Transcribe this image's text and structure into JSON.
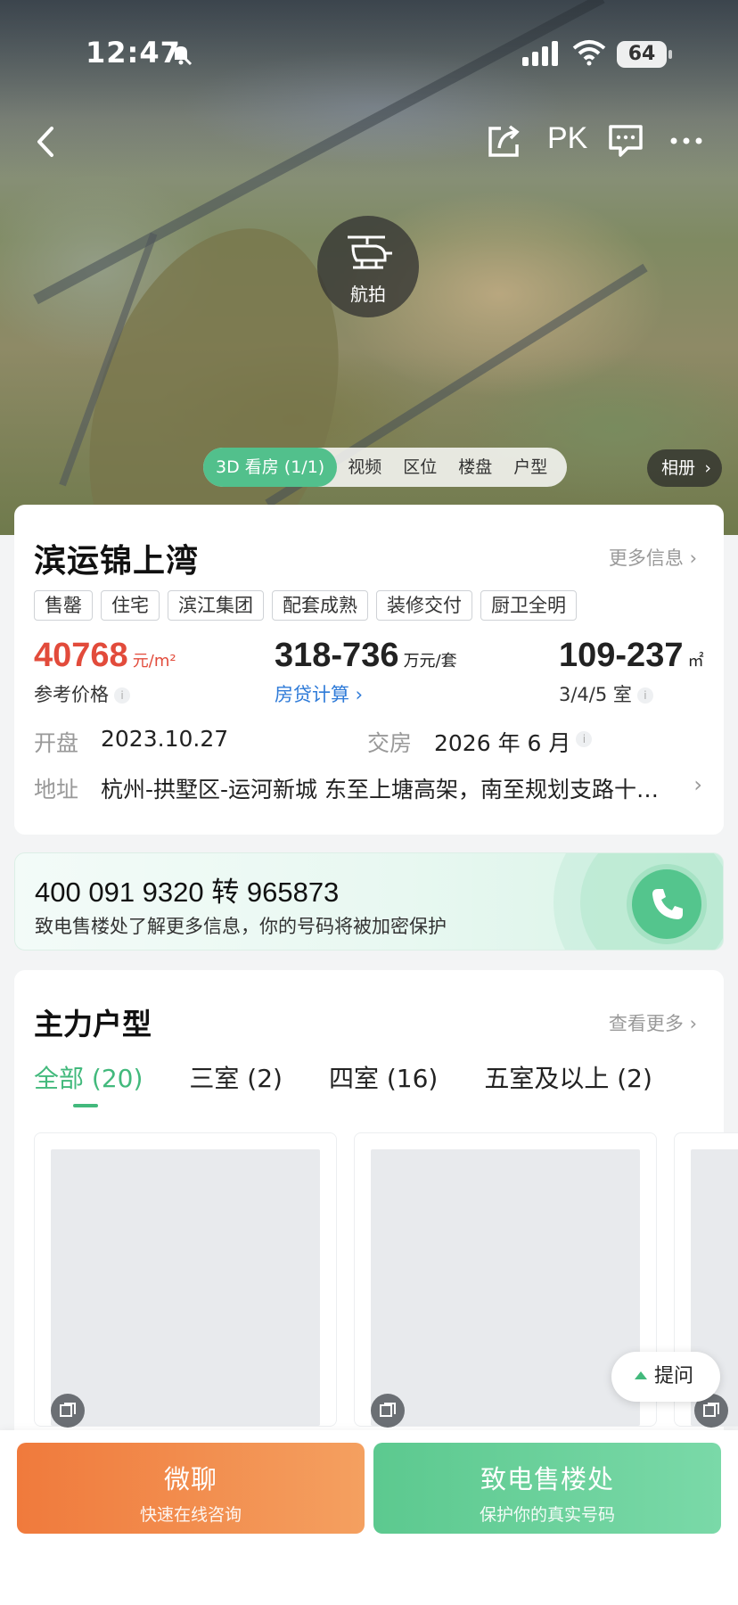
{
  "status_bar": {
    "time": "12:47",
    "battery": "64"
  },
  "nav": {
    "pk_label": "PK"
  },
  "hero": {
    "aerial_label": "航拍",
    "media_tabs": [
      "3D 看房 (1/1)",
      "视频",
      "区位",
      "楼盘",
      "户型"
    ],
    "album_label": "相册"
  },
  "project": {
    "name": "滨运锦上湾",
    "more_info": "更多信息",
    "tags": [
      "售罄",
      "住宅",
      "滨江集团",
      "配套成熟",
      "装修交付",
      "厨卫全明"
    ],
    "price": {
      "value": "40768",
      "unit": "元/m²",
      "label": "参考价格"
    },
    "total": {
      "value": "318-736",
      "unit": "万元/套",
      "label": "房贷计算"
    },
    "area": {
      "value": "109-237",
      "unit": "㎡",
      "label": "3/4/5 室"
    },
    "open_label": "开盘",
    "open_date": "2023.10.27",
    "deliver_label": "交房",
    "deliver_date": "2026 年 6 月",
    "address_label": "地址",
    "address": "杭州-拱墅区-运河新城 东至上塘高架，南至规划支路十…"
  },
  "phone": {
    "number": "400 091 9320 转 965873",
    "desc": "致电售楼处了解更多信息，你的号码将被加密保护",
    "accent": "#54c58d"
  },
  "plans": {
    "title": "主力户型",
    "view_more": "查看更多",
    "tabs": [
      "全部 (20)",
      "三室 (2)",
      "四室 (16)",
      "五室及以上 (2)"
    ]
  },
  "ask_label": "提问",
  "bottom": {
    "chat_main": "微聊",
    "chat_sub": "快速在线咨询",
    "call_main": "致电售楼处",
    "call_sub": "保护你的真实号码"
  },
  "colors": {
    "price_red": "#e24b3b",
    "accent_green": "#42b97c",
    "chat_orange": "#f07a3c"
  },
  "icons": [
    "back-icon",
    "share-icon",
    "message-icon",
    "more-icon",
    "helicopter-icon",
    "phone-icon",
    "gallery-icon",
    "bell-off-icon",
    "signal-icon",
    "wifi-icon"
  ]
}
